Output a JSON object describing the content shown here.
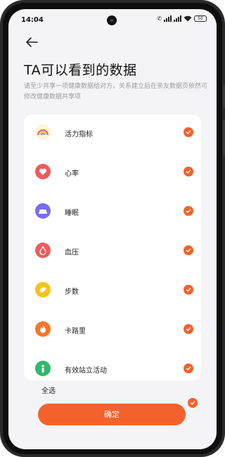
{
  "status_bar": {
    "time": "14:04",
    "battery": "50"
  },
  "header": {
    "title": "TA可以看到的数据",
    "subtitle": "请至少共享一项健康数据给对方，关系建立后在亲友数据页依然可修改健康数据共享项"
  },
  "data_items": [
    {
      "label": "活力指标",
      "icon": "rainbow-icon",
      "color": "#f7c244",
      "checked": true
    },
    {
      "label": "心率",
      "icon": "heart-icon",
      "color": "#f05a5a",
      "checked": true
    },
    {
      "label": "睡眠",
      "icon": "bed-icon",
      "color": "#7a6cf0",
      "checked": true
    },
    {
      "label": "血压",
      "icon": "blood-drop-icon",
      "color": "#ef5b5b",
      "checked": true
    },
    {
      "label": "步数",
      "icon": "shoe-icon",
      "color": "#f9c21a",
      "checked": true
    },
    {
      "label": "卡路里",
      "icon": "flame-icon",
      "color": "#f4762b",
      "checked": true
    },
    {
      "label": "有效站立活动",
      "icon": "standing-icon",
      "color": "#2fb86d",
      "checked": true
    }
  ],
  "footer": {
    "select_all_label": "全选",
    "confirm_label": "确定"
  },
  "colors": {
    "accent": "#f4622b"
  }
}
